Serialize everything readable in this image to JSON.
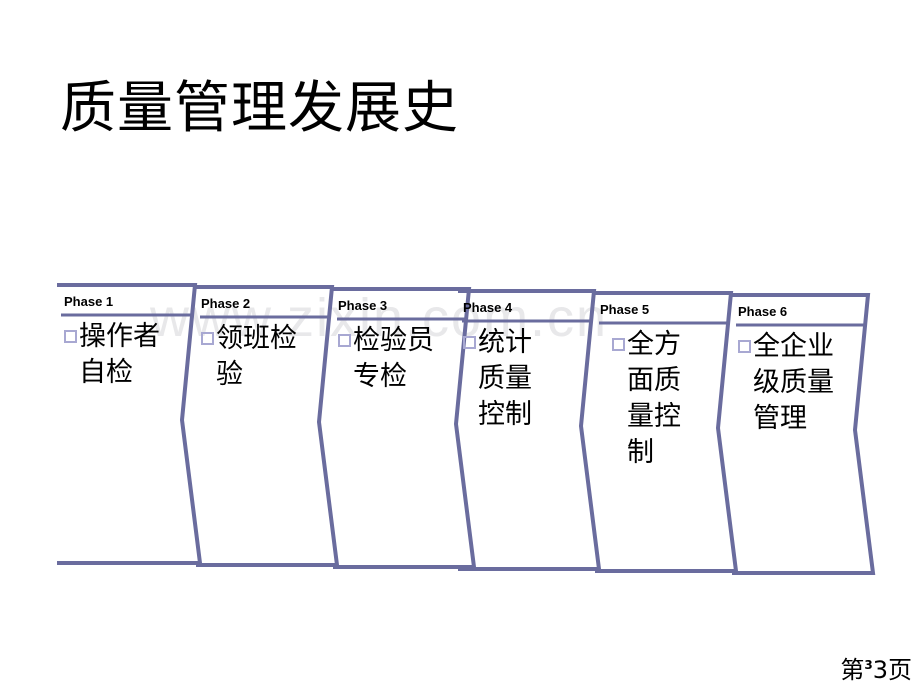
{
  "slide": {
    "title": "质量管理发展史",
    "watermark": "www.zixin.com.cn",
    "background_color": "#FFFFFF"
  },
  "theme": {
    "chevron_border_color": "#6A6C9E",
    "bullet_box_color": "#A8A8D2",
    "text_color": "#000000",
    "watermark_color": "#E8E8EA"
  },
  "diagram": {
    "type": "chevron-process",
    "phase_count": 6,
    "phases": [
      {
        "label": "Phase 1",
        "bullet": "□",
        "text": "操作者自检"
      },
      {
        "label": "Phase 2",
        "bullet": "□",
        "text": "领班检验"
      },
      {
        "label": "Phase 3",
        "bullet": "□",
        "text": "检验员专检"
      },
      {
        "label": "Phase 4",
        "bullet": "□",
        "text": "统计质量控制"
      },
      {
        "label": "Phase 5",
        "bullet": "□",
        "text": "全方面质量控制"
      },
      {
        "label": "Phase 6",
        "bullet": "□",
        "text": "全企业级质量管理"
      }
    ]
  },
  "footer": {
    "page_prefix": "第",
    "page_number": "3",
    "page_suffix": "页",
    "page_superscript": "3"
  }
}
